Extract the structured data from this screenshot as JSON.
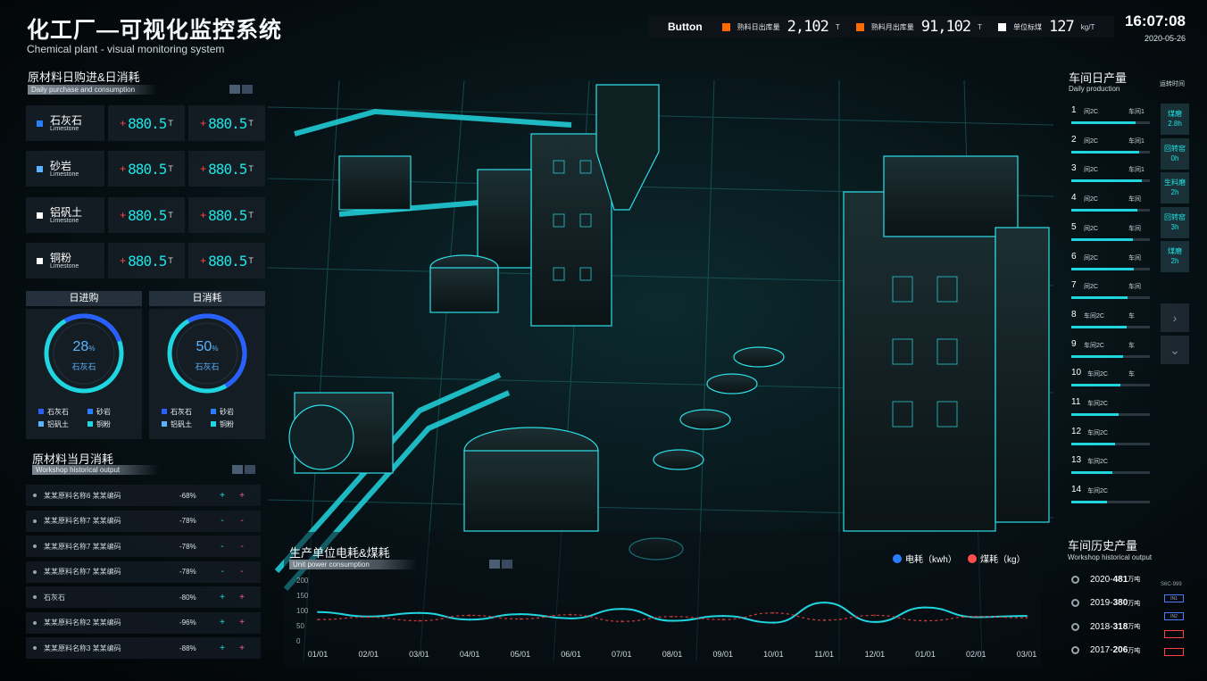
{
  "header": {
    "title": "化工厂—可视化监控系统",
    "subtitle": "Chemical plant - visual monitoring system",
    "button_label": "Button",
    "stats": [
      {
        "label": "熟料日出库量",
        "value": "2,102",
        "unit": "T",
        "color": "#ff6a00"
      },
      {
        "label": "熟料月出库量",
        "value": "91,102",
        "unit": "T",
        "color": "#ff6a00"
      },
      {
        "label": "单位标煤",
        "value": "127",
        "unit": "kg/T",
        "color": "#ffffff"
      }
    ],
    "time": "16:07:08",
    "date": "2020-05-26"
  },
  "raw_materials": {
    "title": "原材料日购进&日消耗",
    "subtitle": "Daily purchase and consumption",
    "rows": [
      {
        "name": "石灰石",
        "en": "Limestone",
        "color": "#2a7fff",
        "plus": "+",
        "purchase": "880.5",
        "consume": "880.5",
        "unit": "T"
      },
      {
        "name": "砂岩",
        "en": "Limestone",
        "color": "#5ab4ff",
        "plus": "+",
        "purchase": "880.5",
        "consume": "880.5",
        "unit": "T"
      },
      {
        "name": "铝矾土",
        "en": "Limestone",
        "color": "#ffffff",
        "plus": "+",
        "purchase": "880.5",
        "consume": "880.5",
        "unit": "T"
      },
      {
        "name": "铜粉",
        "en": "Limestone",
        "color": "#ffffff",
        "plus": "+",
        "purchase": "880.5",
        "consume": "880.5",
        "unit": "T"
      }
    ]
  },
  "rings": [
    {
      "title": "日进购",
      "value": "28",
      "pct_sign": "%",
      "percent": 28,
      "label": "石灰石"
    },
    {
      "title": "日消耗",
      "value": "50",
      "pct_sign": "%",
      "percent": 50,
      "label": "石灰石"
    }
  ],
  "ring_legend": [
    {
      "name": "石灰石",
      "color": "#2a5fff"
    },
    {
      "name": "砂岩",
      "color": "#2a7fff"
    },
    {
      "name": "铝矾土",
      "color": "#5ab4ff"
    },
    {
      "name": "铜粉",
      "color": "#22d6e0"
    }
  ],
  "monthly": {
    "title": "原材料当月消耗",
    "subtitle": "Workshop historical output",
    "rows": [
      {
        "name": "某某原料名称6 某某编码",
        "pct": "-68%",
        "a": "+",
        "b": "+"
      },
      {
        "name": "某某原料名称7 某某编码",
        "pct": "-78%",
        "a": "-",
        "b": "-"
      },
      {
        "name": "某某原料名称7 某某编码",
        "pct": "-78%",
        "a": "-",
        "b": "-"
      },
      {
        "name": "某某原料名称7 某某编码",
        "pct": "-78%",
        "a": "-",
        "b": "-"
      },
      {
        "name": "石灰石",
        "pct": "-80%",
        "a": "+",
        "b": "+"
      },
      {
        "name": "某某原料名称2 某某编码",
        "pct": "-96%",
        "a": "+",
        "b": "+"
      },
      {
        "name": "某某原料名称3 某某编码",
        "pct": "-88%",
        "a": "+",
        "b": "+"
      }
    ]
  },
  "daily_production": {
    "title": "车间日产量",
    "subtitle": "Daily production",
    "rows": [
      {
        "n": "1",
        "w": "间2C",
        "w2": "车间1",
        "fill": 0.82
      },
      {
        "n": "2",
        "w": "间2C",
        "w2": "车间1",
        "fill": 0.86
      },
      {
        "n": "3",
        "w": "间2C",
        "w2": "车间1",
        "fill": 0.9
      },
      {
        "n": "4",
        "w": "间2C",
        "w2": "车间",
        "fill": 0.84
      },
      {
        "n": "5",
        "w": "间2C",
        "w2": "车间",
        "fill": 0.78
      },
      {
        "n": "6",
        "w": "间2C",
        "w2": "车间",
        "fill": 0.8
      },
      {
        "n": "7",
        "w": "间2C",
        "w2": "车间",
        "fill": 0.72
      },
      {
        "n": "8",
        "w": "车间2C",
        "w2": "车",
        "fill": 0.7
      },
      {
        "n": "9",
        "w": "车间2C",
        "w2": "车",
        "fill": 0.66
      },
      {
        "n": "10",
        "w": "车间2C",
        "w2": "车",
        "fill": 0.62
      },
      {
        "n": "11",
        "w": "车间2C",
        "w2": "",
        "fill": 0.6
      },
      {
        "n": "12",
        "w": "车间2C",
        "w2": "",
        "fill": 0.56
      },
      {
        "n": "13",
        "w": "车间2C",
        "w2": "",
        "fill": 0.52
      },
      {
        "n": "14",
        "w": "车间2C",
        "w2": "",
        "fill": 0.46
      }
    ],
    "side_title": "运转时间",
    "side_tabs": [
      {
        "name": "煤磨",
        "val": "2.8h"
      },
      {
        "name": "回转窑",
        "val": "0h"
      },
      {
        "name": "生料磨",
        "val": "2h"
      },
      {
        "name": "回转窑",
        "val": "3h"
      },
      {
        "name": "煤磨",
        "val": "2h"
      }
    ]
  },
  "history": {
    "title": "车间历史产量",
    "subtitle": "Workshop historical output",
    "rows": [
      {
        "year": "2020-",
        "val": "481",
        "unit": "万吨"
      },
      {
        "year": "2019-",
        "val": "380",
        "unit": "万吨"
      },
      {
        "year": "2018-",
        "val": "318",
        "unit": "万吨"
      },
      {
        "year": "2017-",
        "val": "206",
        "unit": "万吨"
      }
    ],
    "mini_label": "S6C-999",
    "mini_items": [
      "IN1",
      "IN2",
      "",
      ""
    ]
  },
  "chart_data": {
    "type": "line",
    "title": "生产单位电耗&煤耗",
    "subtitle": "Unit power consumption",
    "categories": [
      "01/01",
      "02/01",
      "03/01",
      "04/01",
      "05/01",
      "06/01",
      "07/01",
      "08/01",
      "09/01",
      "10/01",
      "11/01",
      "12/01",
      "01/01",
      "02/01",
      "03/01"
    ],
    "y_ticks": [
      "0",
      "50",
      "100",
      "150",
      "200"
    ],
    "ylim": [
      0,
      200
    ],
    "series": [
      {
        "name": "电耗（kwh）",
        "color": "#2a7fff",
        "values": [
          95,
          80,
          92,
          70,
          88,
          74,
          105,
          66,
          82,
          60,
          126,
          62,
          110,
          78,
          82
        ]
      },
      {
        "name": "煤耗（kg）",
        "color": "#ff4d4d",
        "values": [
          70,
          78,
          66,
          84,
          72,
          86,
          64,
          80,
          70,
          92,
          68,
          84,
          66,
          80,
          76
        ]
      }
    ],
    "line_colors": {
      "power": "#1fd6e0",
      "coal": "#d23a3a"
    },
    "grid": false,
    "legend_position": "top-right"
  }
}
